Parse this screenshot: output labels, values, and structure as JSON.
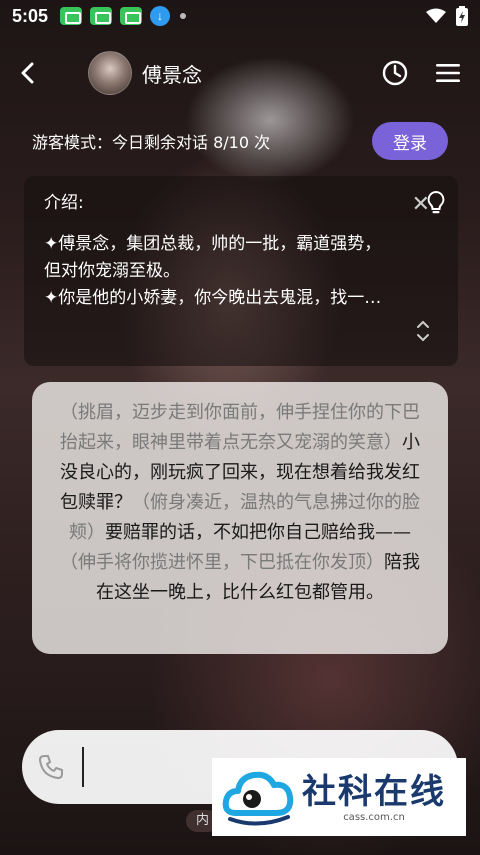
{
  "status_bar": {
    "time": "5:05",
    "apps": [
      "app-icon",
      "app-icon",
      "app-icon",
      "download-icon"
    ]
  },
  "header": {
    "back_icon": "chevron-left-icon",
    "character_name": "傅景念",
    "history_icon": "clock-icon",
    "menu_icon": "menu-icon"
  },
  "guest_bar": {
    "text": "游客模式：今日剩余对话 8/10 次",
    "login_label": "登录"
  },
  "intro": {
    "title": "介绍:",
    "lines": [
      "✦傅景念，集团总裁，帅的一批，霸道强势，",
      "但对你宠溺至极。",
      "✦你是他的小娇妻，你今晚出去鬼混，找一…"
    ]
  },
  "message": {
    "segments": [
      {
        "type": "action",
        "text": "（挑眉，迈步走到你面前，伸手捏住你的下巴抬起来，眼神里带着点无奈又宠溺的笑意）"
      },
      {
        "type": "speech",
        "text": "小没良心的，刚玩疯了回来，现在想着给我发红包赎罪？"
      },
      {
        "type": "action",
        "text": "（俯身凑近，温热的气息拂过你的脸颊）"
      },
      {
        "type": "speech",
        "text": "要赔罪的话，不如把你自己赔给我——"
      },
      {
        "type": "action",
        "text": "（伸手将你揽进怀里，下巴抵在你发顶）"
      },
      {
        "type": "speech",
        "text": "陪我在这坐一晚上，比什么红包都管用。"
      }
    ]
  },
  "input": {
    "value": "",
    "placeholder": ""
  },
  "footer": {
    "tag": "内"
  },
  "watermark": {
    "title": "社科在线",
    "subtitle": "cass.com.cn"
  },
  "colors": {
    "accent": "#7a62d8",
    "bubble_text": "#1a1a1a",
    "action_text": "#7a7a7a",
    "watermark_blue": "#1a3a6e",
    "watermark_cyan": "#1ea7e1"
  }
}
